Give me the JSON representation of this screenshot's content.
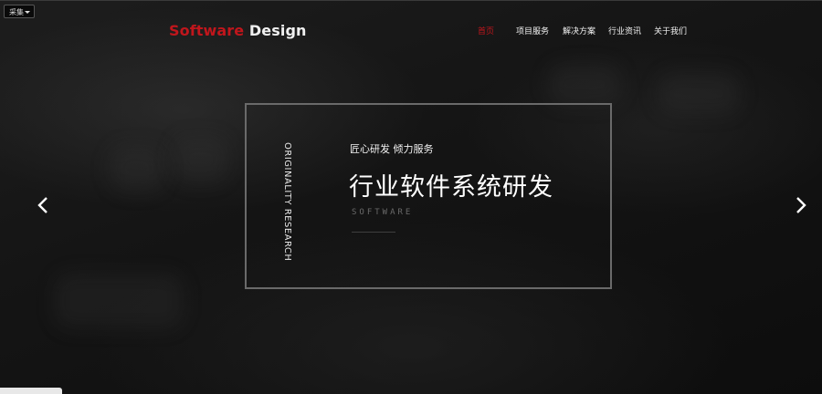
{
  "collect_button": {
    "label": "采集"
  },
  "logo": {
    "part1": "Software",
    "part2": " Design"
  },
  "nav": {
    "items": [
      {
        "label": "首页",
        "active": true
      },
      {
        "label": "项目服务",
        "active": false
      },
      {
        "label": "解决方案",
        "active": false
      },
      {
        "label": "行业资讯",
        "active": false
      },
      {
        "label": "关于我们",
        "active": false
      }
    ]
  },
  "banner": {
    "vertical_text": "ORIGINALITY RESEARCH",
    "subtitle": "匠心研发  倾力服务",
    "headline": "行业软件系统研发",
    "tagline": "SOFTWARE"
  },
  "carousel": {
    "prev_icon": "chevron-left-icon",
    "next_icon": "chevron-right-icon"
  },
  "colors": {
    "accent": "#c0161c",
    "text": "#f2f2f2",
    "frame": "#6a6a6a",
    "background": "#151515"
  }
}
